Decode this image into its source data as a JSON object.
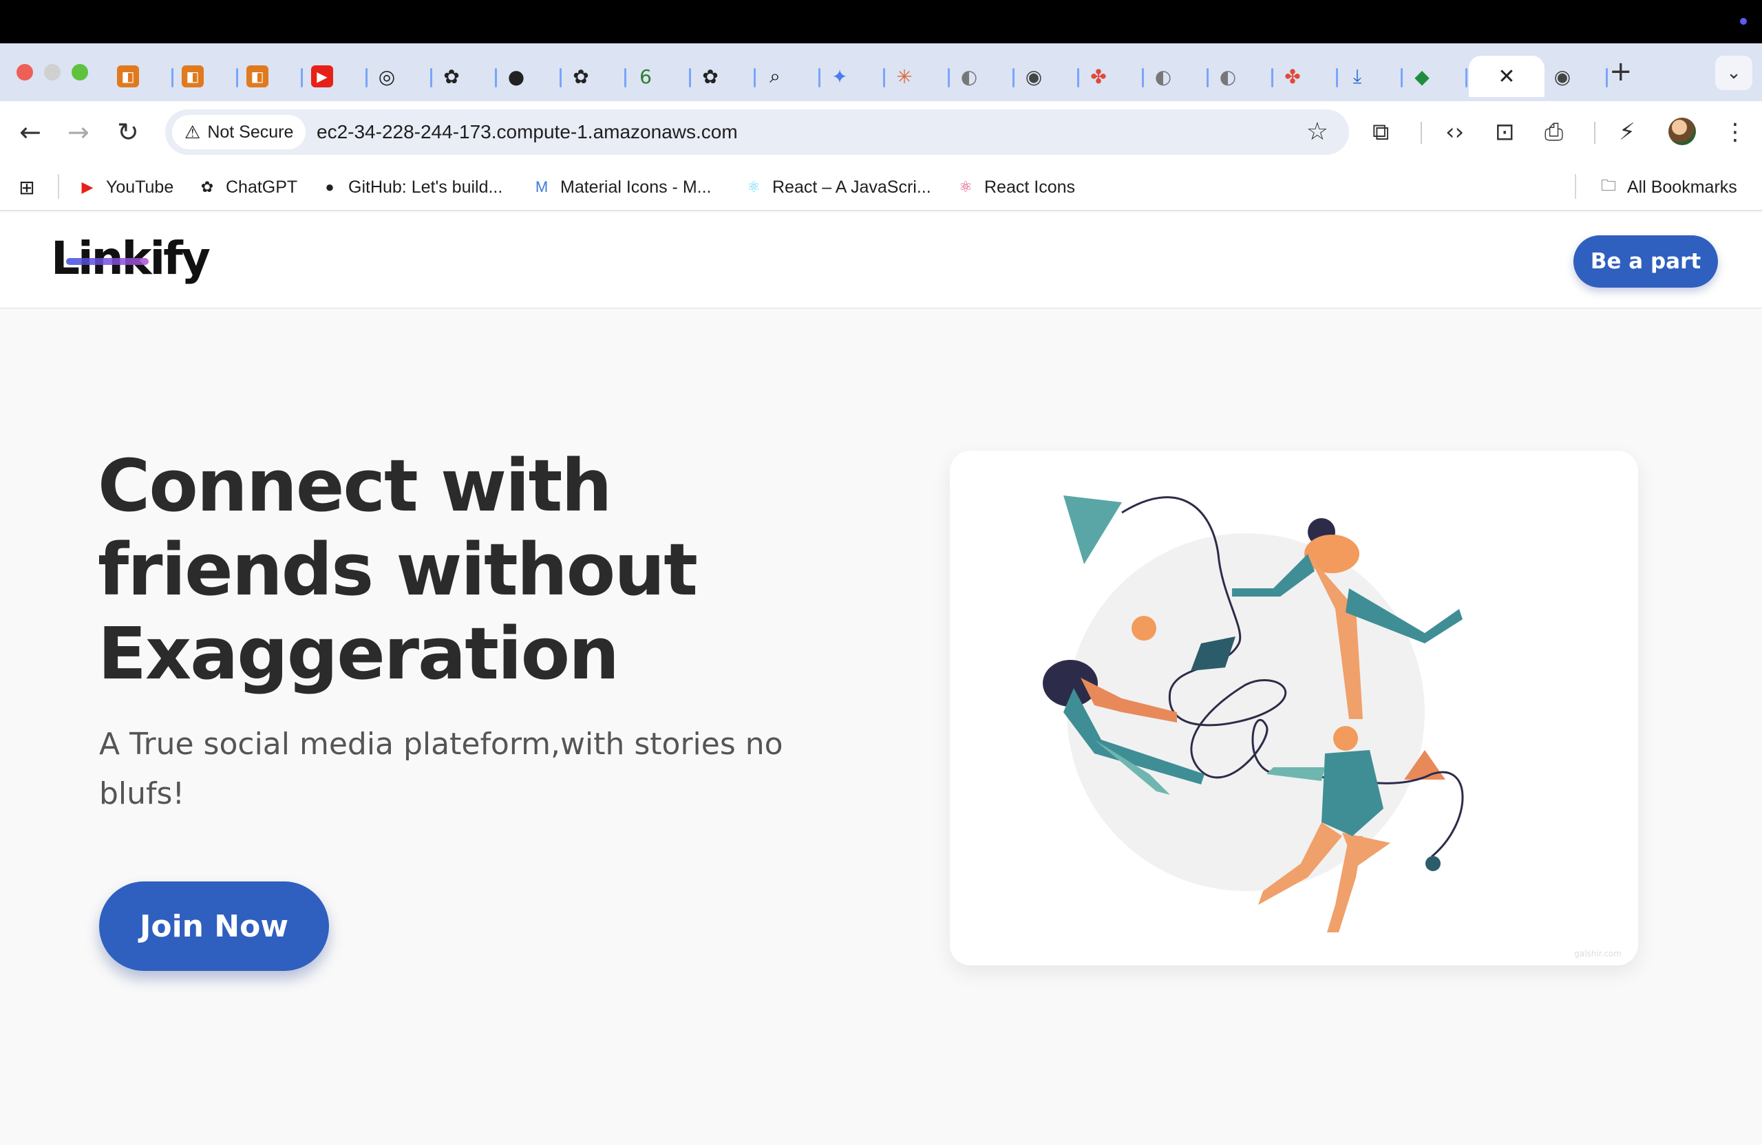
{
  "browser": {
    "tabs": [
      {
        "icon": "aws-icon",
        "color": "#e07a1f",
        "glyph": "◧"
      },
      {
        "icon": "aws-icon",
        "color": "#e07a1f",
        "glyph": "◧"
      },
      {
        "icon": "aws-icon",
        "color": "#e07a1f",
        "glyph": "◧"
      },
      {
        "icon": "youtube-icon",
        "color": "#e62117",
        "glyph": "▶"
      },
      {
        "icon": "github-copilot-icon",
        "color": "#222",
        "glyph": "◎"
      },
      {
        "icon": "chatgpt-icon",
        "color": "#222",
        "glyph": "✿"
      },
      {
        "icon": "github-icon",
        "color": "#222",
        "glyph": "●"
      },
      {
        "icon": "chatgpt-icon",
        "color": "#222",
        "glyph": "✿"
      },
      {
        "icon": "mongodb-icon",
        "color": "#2e7d32",
        "glyph": "6"
      },
      {
        "icon": "chatgpt-icon",
        "color": "#222",
        "glyph": "✿"
      },
      {
        "icon": "search-icon",
        "color": "#111",
        "glyph": "⌕"
      },
      {
        "icon": "gemini-icon",
        "color": "#4b7bec",
        "glyph": "✦"
      },
      {
        "icon": "claude-icon",
        "color": "#d96b3b",
        "glyph": "✳"
      },
      {
        "icon": "globe-icon",
        "color": "#777",
        "glyph": "◐"
      },
      {
        "icon": "chrome-icon",
        "color": "#444",
        "glyph": "◉"
      },
      {
        "icon": "apps-icon",
        "color": "#e0493b",
        "glyph": "✤"
      },
      {
        "icon": "globe-icon",
        "color": "#777",
        "glyph": "◐"
      },
      {
        "icon": "globe-icon",
        "color": "#777",
        "glyph": "◐"
      },
      {
        "icon": "apps-icon",
        "color": "#e0493b",
        "glyph": "✤"
      },
      {
        "icon": "download-icon",
        "color": "#2b6fd6",
        "glyph": "⤓"
      },
      {
        "icon": "mongodb-leaf-icon",
        "color": "#1e8e3e",
        "glyph": "◆"
      }
    ],
    "active_tab_close": "✕",
    "after_tab_icon": "chrome-icon",
    "after_tab_glyph": "◉",
    "new_tab": "+",
    "tab_dropdown": "⌄",
    "security_label": "Not Secure",
    "url": "ec2-34-228-244-173.compute-1.amazonaws.com",
    "bookmarks": [
      {
        "label": "YouTube",
        "icon": "youtube-icon",
        "glyph": "▶",
        "color": "#e62117"
      },
      {
        "label": "ChatGPT",
        "icon": "chatgpt-icon",
        "glyph": "✿",
        "color": "#222"
      },
      {
        "label": "GitHub: Let's build...",
        "icon": "github-icon",
        "glyph": "●",
        "color": "#222"
      },
      {
        "label": "Material Icons - M...",
        "icon": "material-icons-icon",
        "glyph": "M",
        "color": "#3d7bd9"
      },
      {
        "label": "React – A JavaScri...",
        "icon": "react-icon",
        "glyph": "⚛",
        "color": "#61dafb"
      },
      {
        "label": "React Icons",
        "icon": "react-icons-icon",
        "glyph": "⚛",
        "color": "#e0467b"
      }
    ],
    "all_bookmarks": "All Bookmarks"
  },
  "site": {
    "logo": "Linkify",
    "header_cta": "Be a part",
    "hero_title": [
      "Connect with",
      "friends without",
      "Exaggeration"
    ],
    "hero_subtitle": "A True social media plateform,with stories no blufs!",
    "join_button": "Join Now",
    "illustration_watermark": "galshir.com",
    "colors": {
      "primary": "#2f5fbf",
      "teal": "#3f8e96",
      "orange": "#f29b5c",
      "navy": "#2c2c4a"
    }
  }
}
